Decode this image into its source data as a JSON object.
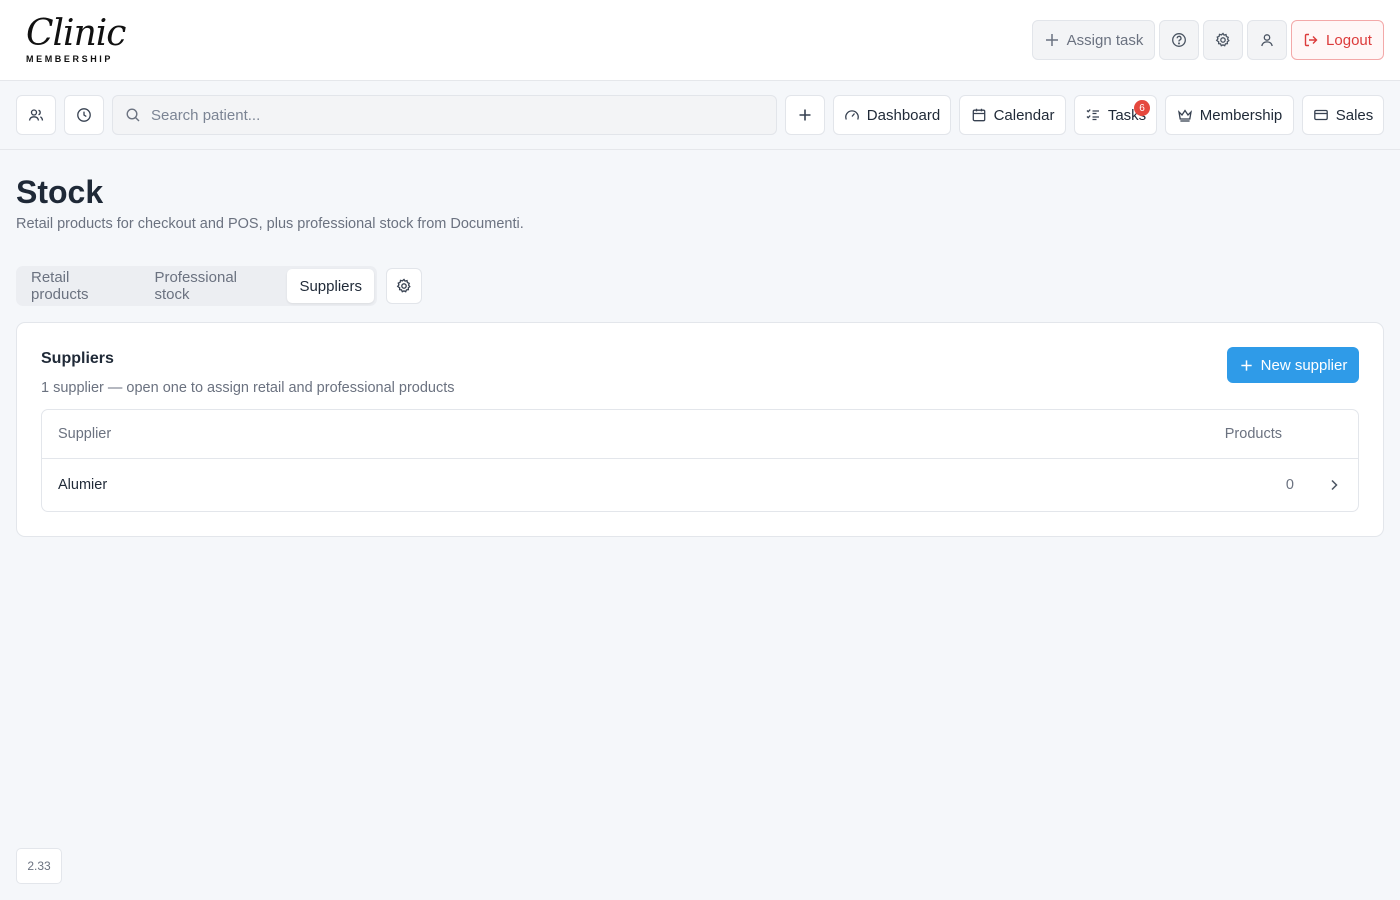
{
  "brand": {
    "logo_script": "Clinic",
    "logo_sub": "MEMBERSHIP"
  },
  "header": {
    "assign_task_label": "Assign task",
    "logout_label": "Logout",
    "icons": [
      "help-icon",
      "gear-icon",
      "user-icon",
      "logout-icon"
    ]
  },
  "nav": {
    "search_placeholder": "Search patient...",
    "items": [
      {
        "label": "Dashboard",
        "icon": "gauge-icon"
      },
      {
        "label": "Calendar",
        "icon": "calendar-icon"
      },
      {
        "label": "Tasks",
        "icon": "tasks-icon",
        "badge": "6"
      },
      {
        "label": "Membership",
        "icon": "crown-icon"
      },
      {
        "label": "Sales",
        "icon": "card-icon"
      }
    ]
  },
  "page": {
    "title": "Stock",
    "subtitle": "Retail products for checkout and POS, plus professional stock from Documenti."
  },
  "tabs": [
    {
      "label": "Retail products",
      "active": false
    },
    {
      "label": "Professional stock",
      "active": false
    },
    {
      "label": "Suppliers",
      "active": true
    }
  ],
  "suppliers": {
    "title": "Suppliers",
    "description": "1 supplier — open one to assign retail and professional products",
    "new_label": "New supplier",
    "columns": [
      "Supplier",
      "Products"
    ],
    "rows": [
      {
        "name": "Alumier",
        "products": "0"
      }
    ]
  },
  "version": "2.33",
  "colors": {
    "primary": "#2f9be8",
    "danger": "#dc3b3b",
    "badge": "#e5483e"
  }
}
